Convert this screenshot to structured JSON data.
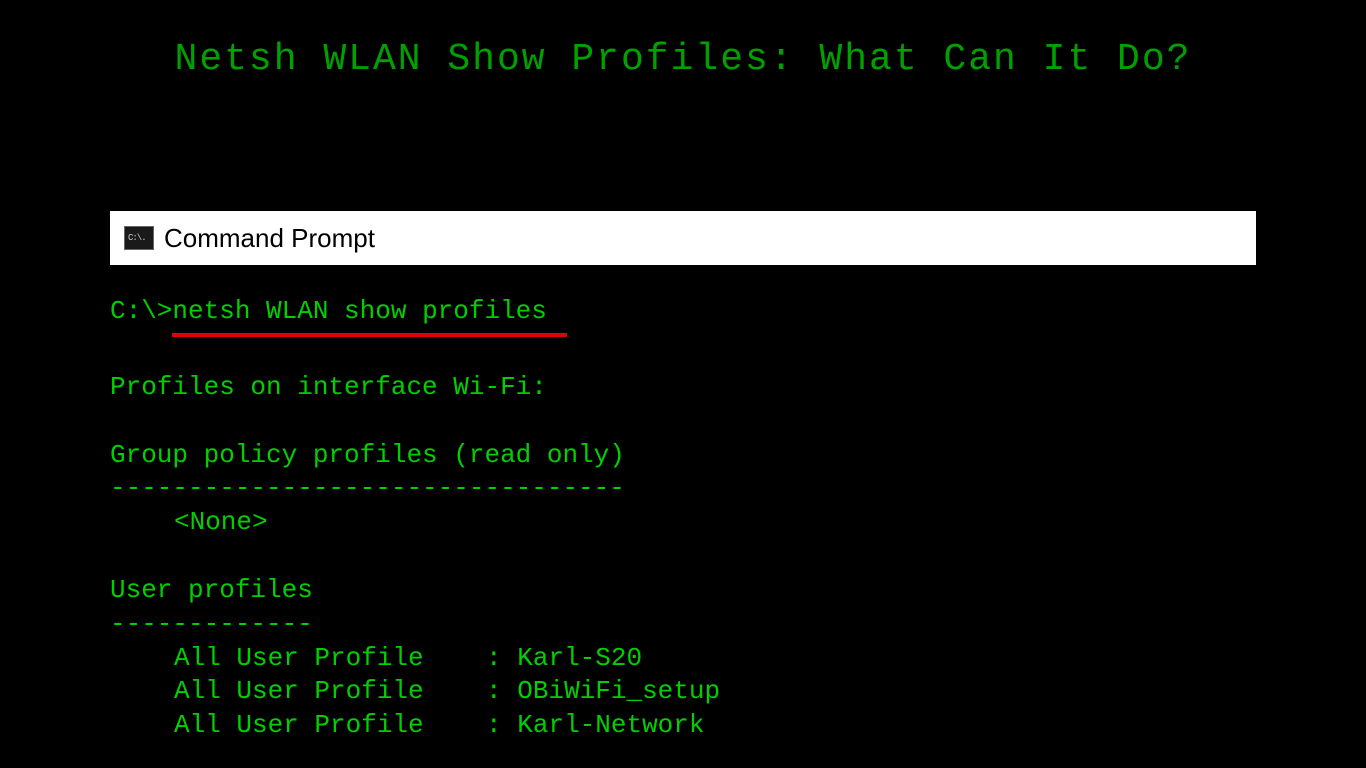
{
  "page": {
    "title": "Netsh WLAN Show Profiles: What Can It Do?"
  },
  "window": {
    "icon_label": "C:\\.",
    "title": "Command Prompt"
  },
  "terminal": {
    "prompt_prefix": "C:\\>",
    "prompt_command": "netsh WLAN show profiles",
    "output": {
      "interface_header": "Profiles on interface Wi-Fi:",
      "group_policy_header": "Group policy profiles (read only)",
      "group_policy_divider": "---------------------------------",
      "group_policy_none": "<None>",
      "user_profiles_header": "User profiles",
      "user_profiles_divider": "-------------",
      "profiles": [
        {
          "label": "All User Profile",
          "sep": "    : ",
          "name": "Karl-S20"
        },
        {
          "label": "All User Profile",
          "sep": "    : ",
          "name": "OBiWiFi_setup"
        },
        {
          "label": "All User Profile",
          "sep": "    : ",
          "name": "Karl-Network"
        }
      ]
    }
  }
}
